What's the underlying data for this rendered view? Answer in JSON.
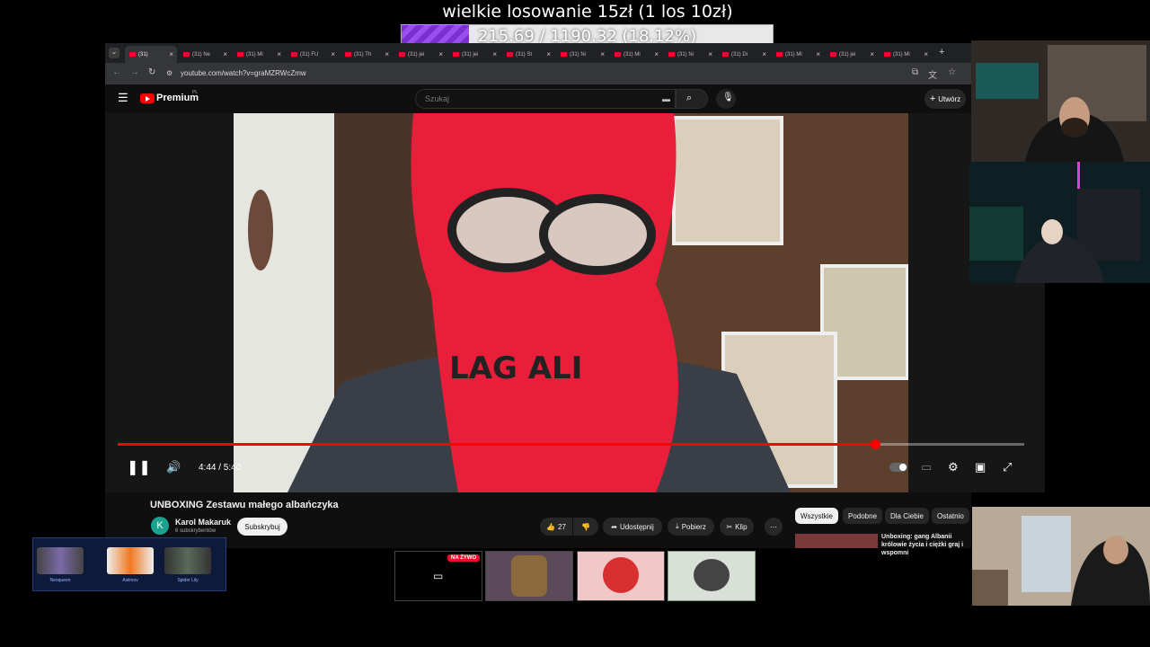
{
  "overlay": {
    "goal_title": "wielkie losowanie 15zł (1 los 10zł)",
    "goal_progress": "215.69 / 1190.32 (18.12%)",
    "goal_fraction": 0.1812
  },
  "browser": {
    "tabs": [
      {
        "label": "(31)"
      },
      {
        "label": "(31) Ne"
      },
      {
        "label": "(31) Mi"
      },
      {
        "label": "(31) FU"
      },
      {
        "label": "(31) Th"
      },
      {
        "label": "(31) jei"
      },
      {
        "label": "(31) jei"
      },
      {
        "label": "(31) St"
      },
      {
        "label": "(31) Ni"
      },
      {
        "label": "(31) Mi"
      },
      {
        "label": "(31) Ni"
      },
      {
        "label": "(31) Di"
      },
      {
        "label": "(31) Mi"
      },
      {
        "label": "(31) jei"
      },
      {
        "label": "(31) Mi"
      }
    ],
    "url": "youtube.com/watch?v=graMZRWcZmw"
  },
  "youtube": {
    "logo_text": "Premium",
    "logo_region": "PL",
    "search_placeholder": "Szukaj",
    "create_label": "Utwórz",
    "player": {
      "time": "4:44 / 5:40",
      "progress_fraction": 0.835
    },
    "video_title": "UNBOXING Zestawu małego albańczyka",
    "channel_initial": "K",
    "channel_name": "Karol Makaruk",
    "subscriber_count": "6 subskrybentów",
    "subscribe_label": "Subskrybuj",
    "like_count": "27",
    "share_label": "Udostępnij",
    "download_label": "Pobierz",
    "clip_label": "Klip",
    "chips": [
      "Wszystkie",
      "Podobne",
      "Dla Ciebie",
      "Ostatnio"
    ],
    "reco_title": "Unboxing: gang Albanii królowie życia i ciężki graj i wspomni"
  },
  "bottom": {
    "skins": [
      {
        "name": "Neoqueen"
      },
      {
        "name": "Asiimov"
      },
      {
        "name": "Spider Lily"
      }
    ],
    "live_badge": "NA ŻYWO"
  },
  "colors": {
    "youtube_red": "#ff0000",
    "goal_purple": "#8a3fe0",
    "page_bg": "#0f0f0f"
  }
}
